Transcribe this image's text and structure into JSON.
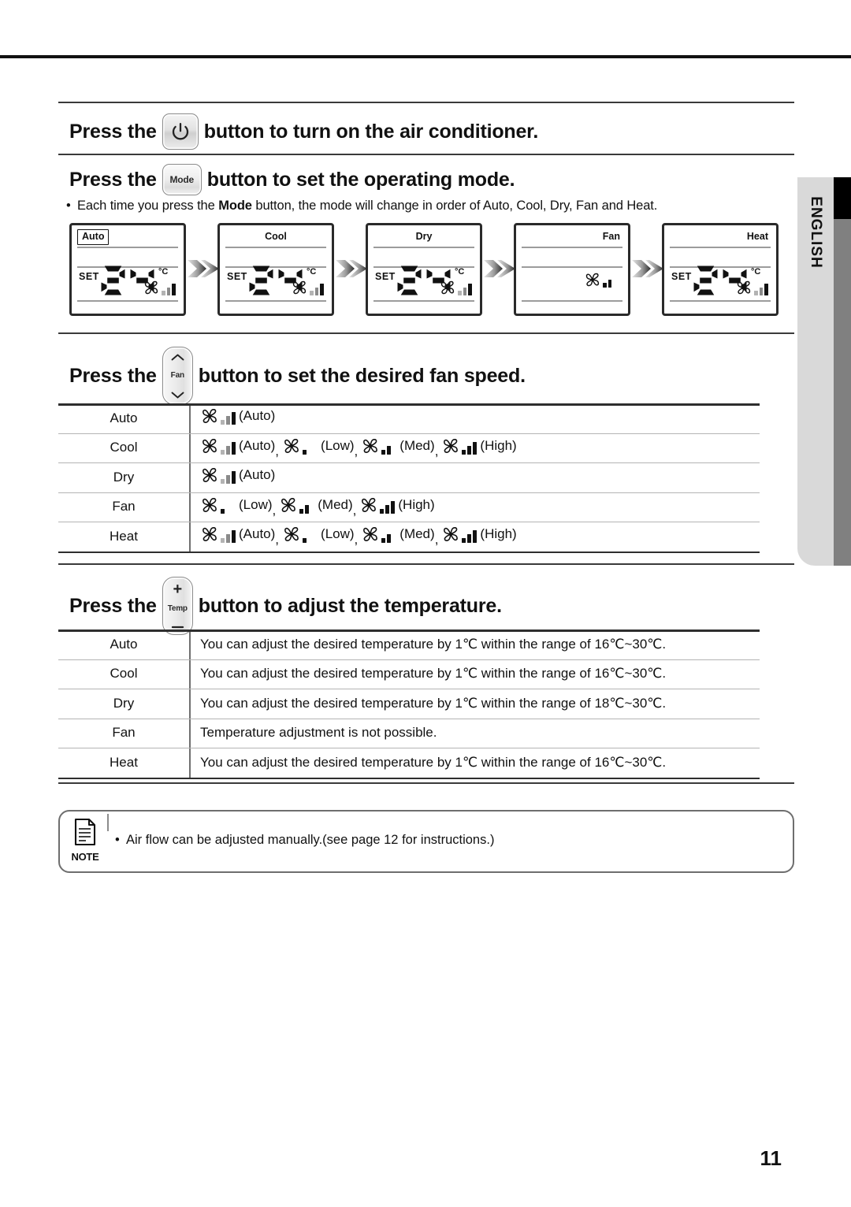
{
  "document": {
    "page_number": "11",
    "language_tab": "ENGLISH"
  },
  "sections": [
    {
      "id": "power",
      "prefix": "Press the",
      "button_icon": "power-icon",
      "suffix": "button to turn on the air conditioner."
    },
    {
      "id": "mode",
      "prefix": "Press the",
      "button_label": "Mode",
      "suffix": "button to set the operating mode.",
      "bullet_parts": {
        "before": "Each time you press the ",
        "bold": "Mode",
        "after": " button, the mode will change in order of Auto, Cool, Dry, Fan and Heat."
      }
    },
    {
      "id": "fanspeed",
      "prefix": "Press the",
      "button_label": "Fan",
      "suffix": "button to set the desired fan speed."
    },
    {
      "id": "temperature",
      "prefix": "Press the",
      "button_label": "Temp",
      "button_plus": "+",
      "button_minus": "—",
      "suffix": "button to adjust the temperature."
    }
  ],
  "lcd_panels": [
    {
      "mode": "Auto",
      "label_style": "boxed",
      "set_label": "SET",
      "temp": "24",
      "unit": "°C",
      "fan_level": "auto",
      "show_temp": true
    },
    {
      "mode": "Cool",
      "label_style": "center",
      "set_label": "SET",
      "temp": "24",
      "unit": "°C",
      "fan_level": "auto",
      "show_temp": true
    },
    {
      "mode": "Dry",
      "label_style": "center",
      "set_label": "SET",
      "temp": "24",
      "unit": "°C",
      "fan_level": "auto",
      "show_temp": true
    },
    {
      "mode": "Fan",
      "label_style": "right",
      "set_label": "",
      "temp": "",
      "unit": "",
      "fan_level": "med",
      "show_temp": false
    },
    {
      "mode": "Heat",
      "label_style": "right",
      "set_label": "SET",
      "temp": "24",
      "unit": "°C",
      "fan_level": "auto",
      "show_temp": true
    }
  ],
  "fan_speed_table": {
    "rows": [
      {
        "mode": "Auto",
        "options": [
          {
            "level": "auto",
            "label": "(Auto)"
          }
        ]
      },
      {
        "mode": "Cool",
        "options": [
          {
            "level": "auto",
            "label": "(Auto)"
          },
          {
            "level": "low",
            "label": "(Low)"
          },
          {
            "level": "med",
            "label": "(Med)"
          },
          {
            "level": "high",
            "label": "(High)"
          }
        ]
      },
      {
        "mode": "Dry",
        "options": [
          {
            "level": "auto",
            "label": "(Auto)"
          }
        ]
      },
      {
        "mode": "Fan",
        "options": [
          {
            "level": "low",
            "label": "(Low)"
          },
          {
            "level": "med",
            "label": "(Med)"
          },
          {
            "level": "high",
            "label": "(High)"
          }
        ]
      },
      {
        "mode": "Heat",
        "options": [
          {
            "level": "auto",
            "label": "(Auto)"
          },
          {
            "level": "low",
            "label": "(Low)"
          },
          {
            "level": "med",
            "label": "(Med)"
          },
          {
            "level": "high",
            "label": "(High)"
          }
        ]
      }
    ]
  },
  "temperature_table": {
    "rows": [
      {
        "mode": "Auto",
        "text": "You can adjust the desired temperature by 1℃ within the range of 16℃~30℃."
      },
      {
        "mode": "Cool",
        "text": "You can adjust the desired temperature by 1℃ within the range of 16℃~30℃."
      },
      {
        "mode": "Dry",
        "text": "You can adjust the desired temperature by 1℃ within the range of 18℃~30℃."
      },
      {
        "mode": "Fan",
        "text": "Temperature adjustment is not possible."
      },
      {
        "mode": "Heat",
        "text": "You can adjust the desired temperature by 1℃ within the range of 16℃~30℃."
      }
    ]
  },
  "note": {
    "label": "NOTE",
    "bullet": "Air flow can be adjusted manually.(see page 12 for instructions.)"
  },
  "colors": {
    "rule_dark": "#2e2e2e",
    "rule_light": "#b4b4b4",
    "tab_bg": "#d9d9d9",
    "tab_black": "#000000",
    "tab_gray": "#808080",
    "bar_active": "#111111",
    "bar_inactive": "#9b9b9b"
  }
}
